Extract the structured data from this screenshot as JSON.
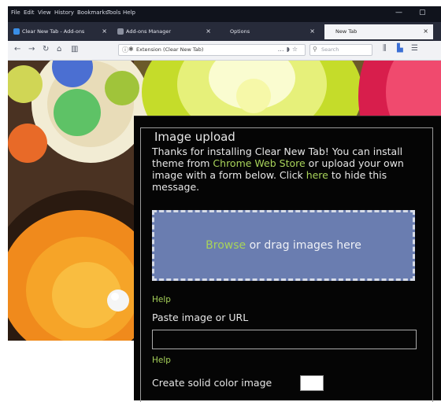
{
  "menu": [
    "File",
    "Edit",
    "View",
    "History",
    "Bookmarks",
    "Tools",
    "Help"
  ],
  "window_controls": {
    "minimize": "—",
    "maximize": "▢"
  },
  "tabs": [
    {
      "label": "Clear New Tab - Add-ons",
      "active": false
    },
    {
      "label": "Add-ons Manager",
      "active": false
    },
    {
      "label": "Options",
      "active": false
    },
    {
      "label": "New Tab",
      "active": true
    }
  ],
  "toolbar": {
    "url": "Extension (Clear New Tab)",
    "search_placeholder": "Search"
  },
  "upload": {
    "legend": "Image upload",
    "intro_before_store": "Thanks for installing Clear New Tab! You can install theme from ",
    "store_link": "Chrome Web Store",
    "intro_after_store": " or upload your own image with a form below. Click ",
    "here_link": "here",
    "intro_end": " to hide this message.",
    "browse_link": "Browse",
    "drop_text": " or drag images here",
    "help1": "Help",
    "paste_label": "Paste image or URL",
    "help2": "Help",
    "solid_label": "Create solid color image"
  },
  "colors": {
    "panel_bg": "#050505",
    "link": "#a8d35a",
    "dropzone": "#6a7db0"
  }
}
